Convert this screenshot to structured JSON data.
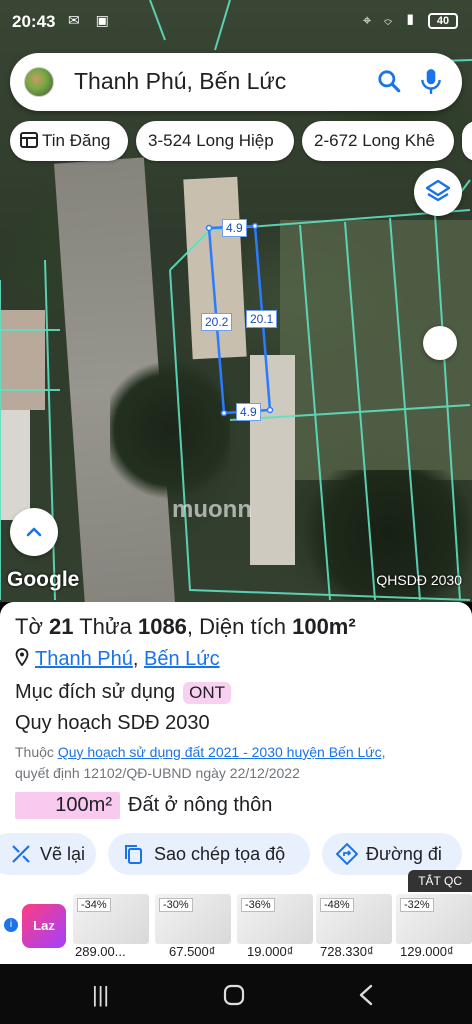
{
  "status_bar": {
    "time": "20:43",
    "battery": "40"
  },
  "search": {
    "query": "Thanh Phú, Bến Lức"
  },
  "chips": [
    {
      "label": "Tin Đăng"
    },
    {
      "label": "3-524 Long Hiệp"
    },
    {
      "label": "2-672 Long Khê"
    }
  ],
  "map": {
    "parcel_labels": {
      "top": "4.9",
      "bottom": "4.9",
      "left": "20.2",
      "right": "20.1"
    },
    "google_logo": "Google",
    "layer_label": "QHSDĐ 2030",
    "watermark": "muonn"
  },
  "parcel": {
    "title_prefix": "Tờ",
    "sheet": "21",
    "title_mid": "Thửa",
    "plot": "1086",
    "area_label": ", Diện tích",
    "area_value": "100m²",
    "commune": "Thanh Phú",
    "district": "Bến Lức",
    "purpose_label": "Mục đích sử dụng",
    "purpose_code": "ONT",
    "plan_label": "Quy hoạch SDĐ 2030",
    "ref_prefix": "Thuộc",
    "ref_link": "Quy hoạch sử dụng đất 2021 - 2030 huyện Bến Lức,",
    "ref_decision": "quyết định 12102/QĐ-UBND ngày 22/12/2022",
    "usage_area": "100m²",
    "usage_type": "Đất ở nông thôn"
  },
  "actions": [
    {
      "label": "Vẽ lại"
    },
    {
      "label": "Sao chép tọa độ"
    },
    {
      "label": "Đường đi"
    }
  ],
  "ads": {
    "close_label": "TẮT QC",
    "brand": "Laz",
    "products": [
      {
        "discount": "-34%",
        "price": "289.00..."
      },
      {
        "discount": "-30%",
        "price": "67.500₫"
      },
      {
        "discount": "-36%",
        "price": "19.000₫"
      },
      {
        "discount": "-48%",
        "price": "728.330₫"
      },
      {
        "discount": "-32%",
        "price": "129.000₫"
      }
    ]
  },
  "colors": {
    "plan_lines": "#5fe0c0",
    "parcel_outline": "#2b7bff",
    "ont_tag": "#f9d1f0",
    "action_bg": "#e8f0fe"
  }
}
